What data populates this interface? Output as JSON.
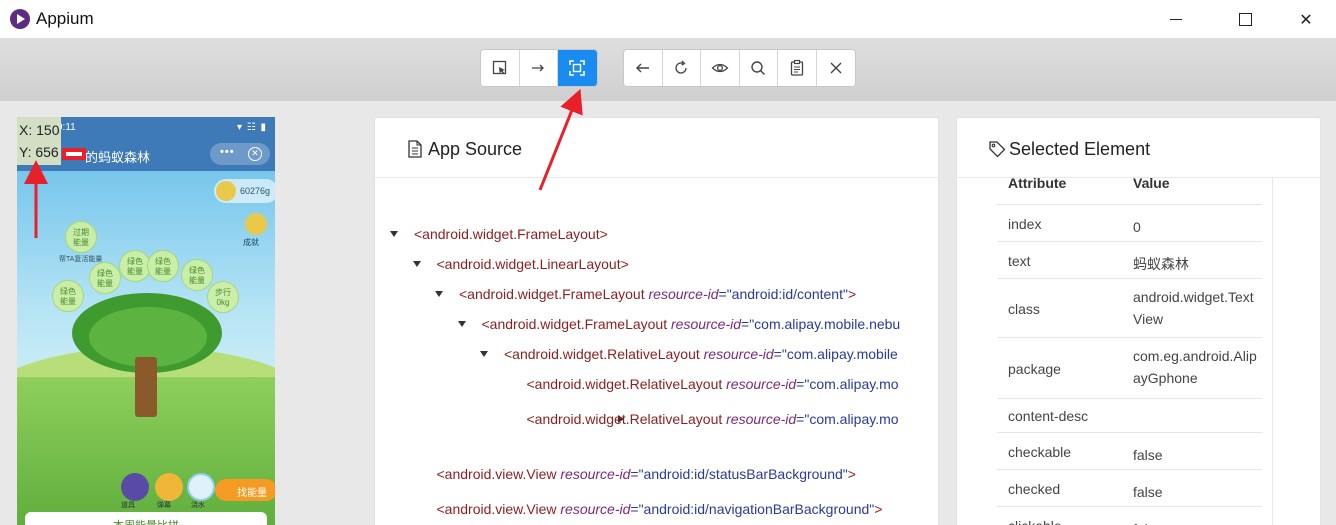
{
  "window": {
    "title": "Appium",
    "minimize_symbol": "",
    "close_symbol": "✕"
  },
  "toolbar": {
    "group1": [
      {
        "name": "select-elements-button",
        "icon": "cursor-select-icon",
        "active": false
      },
      {
        "name": "swipe-by-coordinates-button",
        "icon": "arrow-right-icon",
        "active": false
      },
      {
        "name": "tap-by-coordinates-button",
        "icon": "crosshair-frame-icon",
        "active": true
      }
    ],
    "group2": [
      {
        "name": "back-button",
        "icon": "arrow-left-icon"
      },
      {
        "name": "refresh-button",
        "icon": "refresh-icon"
      },
      {
        "name": "show-hide-button",
        "icon": "eye-icon"
      },
      {
        "name": "search-button",
        "icon": "search-icon"
      },
      {
        "name": "copy-xml-button",
        "icon": "clipboard-icon"
      },
      {
        "name": "quit-session-button",
        "icon": "close-icon"
      }
    ]
  },
  "coords": {
    "x_label": "X: 150",
    "y_label": "Y: 656"
  },
  "phone": {
    "status_time": "9:11",
    "status_icons": "▾ ☷ ▮",
    "header_title": "的蚂蚁森林",
    "capsule_dots": "•••",
    "capsule_close": "⊗",
    "coins": "60276g",
    "achievement": "成就",
    "bubbles": [
      {
        "label": "过期\n能量"
      },
      {
        "label": "绿色\n能量"
      },
      {
        "label": "绿色\n能量"
      },
      {
        "label": "绿色\n能量"
      },
      {
        "label": "绿色\n能量"
      },
      {
        "label": "绿色\n能量"
      },
      {
        "label": "步行\n0kg"
      }
    ],
    "help_label": "帮TA复活能量",
    "tools": [
      {
        "label": "道具",
        "color": "#5a4aa8"
      },
      {
        "label": "弹幕",
        "color": "#f0b63a"
      },
      {
        "label": "浇水",
        "color": "#8fd0ef"
      }
    ],
    "find_energy": "找能量",
    "rank_label": "本周能量比拼"
  },
  "source": {
    "title": "App Source",
    "nodes": [
      {
        "depth": 0,
        "caret": "down",
        "tag": "<android.widget.FrameLayout>",
        "attr": "",
        "val": "",
        "close": ""
      },
      {
        "depth": 1,
        "caret": "down",
        "tag": "<android.widget.LinearLayout>",
        "attr": "",
        "val": "",
        "close": ""
      },
      {
        "depth": 2,
        "caret": "down",
        "tag": "<android.widget.FrameLayout ",
        "attr": "resource-id",
        "val": "=\"android:id/content\"",
        "close": ">"
      },
      {
        "depth": 3,
        "caret": "down",
        "tag": "<android.widget.FrameLayout ",
        "attr": "resource-id",
        "val": "=\"com.alipay.mobile.nebu",
        "close": ""
      },
      {
        "depth": 4,
        "caret": "down",
        "tag": "<android.widget.RelativeLayout ",
        "attr": "resource-id",
        "val": "=\"com.alipay.mobile",
        "close": ""
      },
      {
        "depth": 5,
        "caret": "none",
        "tag": "<android.widget.RelativeLayout ",
        "attr": "resource-id",
        "val": "=\"com.alipay.mo",
        "close": ""
      },
      {
        "depth": 5,
        "caret": "right",
        "tag": "<android.widget.RelativeLayout ",
        "attr": "resource-id",
        "val": "=\"com.alipay.mo",
        "close": ""
      },
      {
        "depth": 1,
        "caret": "none",
        "tag": "<android.view.View ",
        "attr": "resource-id",
        "val": "=\"android:id/statusBarBackground\"",
        "close": ">"
      },
      {
        "depth": 1,
        "caret": "none",
        "tag": "<android.view.View ",
        "attr": "resource-id",
        "val": "=\"android:id/navigationBarBackground\"",
        "close": ">"
      }
    ]
  },
  "selected": {
    "title": "Selected Element",
    "header": {
      "attribute": "Attribute",
      "value": "Value"
    },
    "rows": [
      {
        "attribute": "index",
        "value": "0"
      },
      {
        "attribute": "text",
        "value": "蚂蚁森林"
      },
      {
        "attribute": "class",
        "value": "android.widget.TextView"
      },
      {
        "attribute": "package",
        "value": "com.eg.android.AlipayGphone"
      },
      {
        "attribute": "content-desc",
        "value": ""
      },
      {
        "attribute": "checkable",
        "value": "false"
      },
      {
        "attribute": "checked",
        "value": "false"
      },
      {
        "attribute": "clickable",
        "value": "false"
      }
    ]
  }
}
